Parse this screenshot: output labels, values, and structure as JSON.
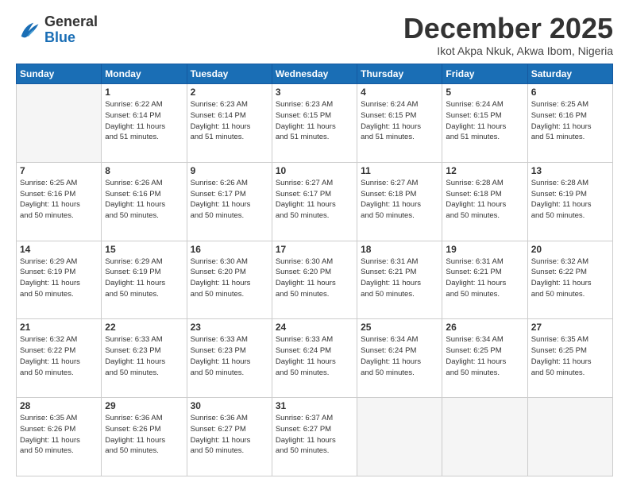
{
  "header": {
    "logo_general": "General",
    "logo_blue": "Blue",
    "month": "December 2025",
    "location": "Ikot Akpa Nkuk, Akwa Ibom, Nigeria"
  },
  "days_of_week": [
    "Sunday",
    "Monday",
    "Tuesday",
    "Wednesday",
    "Thursday",
    "Friday",
    "Saturday"
  ],
  "weeks": [
    [
      {
        "day": "",
        "info": ""
      },
      {
        "day": "1",
        "info": "Sunrise: 6:22 AM\nSunset: 6:14 PM\nDaylight: 11 hours\nand 51 minutes."
      },
      {
        "day": "2",
        "info": "Sunrise: 6:23 AM\nSunset: 6:14 PM\nDaylight: 11 hours\nand 51 minutes."
      },
      {
        "day": "3",
        "info": "Sunrise: 6:23 AM\nSunset: 6:15 PM\nDaylight: 11 hours\nand 51 minutes."
      },
      {
        "day": "4",
        "info": "Sunrise: 6:24 AM\nSunset: 6:15 PM\nDaylight: 11 hours\nand 51 minutes."
      },
      {
        "day": "5",
        "info": "Sunrise: 6:24 AM\nSunset: 6:15 PM\nDaylight: 11 hours\nand 51 minutes."
      },
      {
        "day": "6",
        "info": "Sunrise: 6:25 AM\nSunset: 6:16 PM\nDaylight: 11 hours\nand 51 minutes."
      }
    ],
    [
      {
        "day": "7",
        "info": "Sunrise: 6:25 AM\nSunset: 6:16 PM\nDaylight: 11 hours\nand 50 minutes."
      },
      {
        "day": "8",
        "info": "Sunrise: 6:26 AM\nSunset: 6:16 PM\nDaylight: 11 hours\nand 50 minutes."
      },
      {
        "day": "9",
        "info": "Sunrise: 6:26 AM\nSunset: 6:17 PM\nDaylight: 11 hours\nand 50 minutes."
      },
      {
        "day": "10",
        "info": "Sunrise: 6:27 AM\nSunset: 6:17 PM\nDaylight: 11 hours\nand 50 minutes."
      },
      {
        "day": "11",
        "info": "Sunrise: 6:27 AM\nSunset: 6:18 PM\nDaylight: 11 hours\nand 50 minutes."
      },
      {
        "day": "12",
        "info": "Sunrise: 6:28 AM\nSunset: 6:18 PM\nDaylight: 11 hours\nand 50 minutes."
      },
      {
        "day": "13",
        "info": "Sunrise: 6:28 AM\nSunset: 6:19 PM\nDaylight: 11 hours\nand 50 minutes."
      }
    ],
    [
      {
        "day": "14",
        "info": "Sunrise: 6:29 AM\nSunset: 6:19 PM\nDaylight: 11 hours\nand 50 minutes."
      },
      {
        "day": "15",
        "info": "Sunrise: 6:29 AM\nSunset: 6:19 PM\nDaylight: 11 hours\nand 50 minutes."
      },
      {
        "day": "16",
        "info": "Sunrise: 6:30 AM\nSunset: 6:20 PM\nDaylight: 11 hours\nand 50 minutes."
      },
      {
        "day": "17",
        "info": "Sunrise: 6:30 AM\nSunset: 6:20 PM\nDaylight: 11 hours\nand 50 minutes."
      },
      {
        "day": "18",
        "info": "Sunrise: 6:31 AM\nSunset: 6:21 PM\nDaylight: 11 hours\nand 50 minutes."
      },
      {
        "day": "19",
        "info": "Sunrise: 6:31 AM\nSunset: 6:21 PM\nDaylight: 11 hours\nand 50 minutes."
      },
      {
        "day": "20",
        "info": "Sunrise: 6:32 AM\nSunset: 6:22 PM\nDaylight: 11 hours\nand 50 minutes."
      }
    ],
    [
      {
        "day": "21",
        "info": "Sunrise: 6:32 AM\nSunset: 6:22 PM\nDaylight: 11 hours\nand 50 minutes."
      },
      {
        "day": "22",
        "info": "Sunrise: 6:33 AM\nSunset: 6:23 PM\nDaylight: 11 hours\nand 50 minutes."
      },
      {
        "day": "23",
        "info": "Sunrise: 6:33 AM\nSunset: 6:23 PM\nDaylight: 11 hours\nand 50 minutes."
      },
      {
        "day": "24",
        "info": "Sunrise: 6:33 AM\nSunset: 6:24 PM\nDaylight: 11 hours\nand 50 minutes."
      },
      {
        "day": "25",
        "info": "Sunrise: 6:34 AM\nSunset: 6:24 PM\nDaylight: 11 hours\nand 50 minutes."
      },
      {
        "day": "26",
        "info": "Sunrise: 6:34 AM\nSunset: 6:25 PM\nDaylight: 11 hours\nand 50 minutes."
      },
      {
        "day": "27",
        "info": "Sunrise: 6:35 AM\nSunset: 6:25 PM\nDaylight: 11 hours\nand 50 minutes."
      }
    ],
    [
      {
        "day": "28",
        "info": "Sunrise: 6:35 AM\nSunset: 6:26 PM\nDaylight: 11 hours\nand 50 minutes."
      },
      {
        "day": "29",
        "info": "Sunrise: 6:36 AM\nSunset: 6:26 PM\nDaylight: 11 hours\nand 50 minutes."
      },
      {
        "day": "30",
        "info": "Sunrise: 6:36 AM\nSunset: 6:27 PM\nDaylight: 11 hours\nand 50 minutes."
      },
      {
        "day": "31",
        "info": "Sunrise: 6:37 AM\nSunset: 6:27 PM\nDaylight: 11 hours\nand 50 minutes."
      },
      {
        "day": "",
        "info": ""
      },
      {
        "day": "",
        "info": ""
      },
      {
        "day": "",
        "info": ""
      }
    ]
  ]
}
